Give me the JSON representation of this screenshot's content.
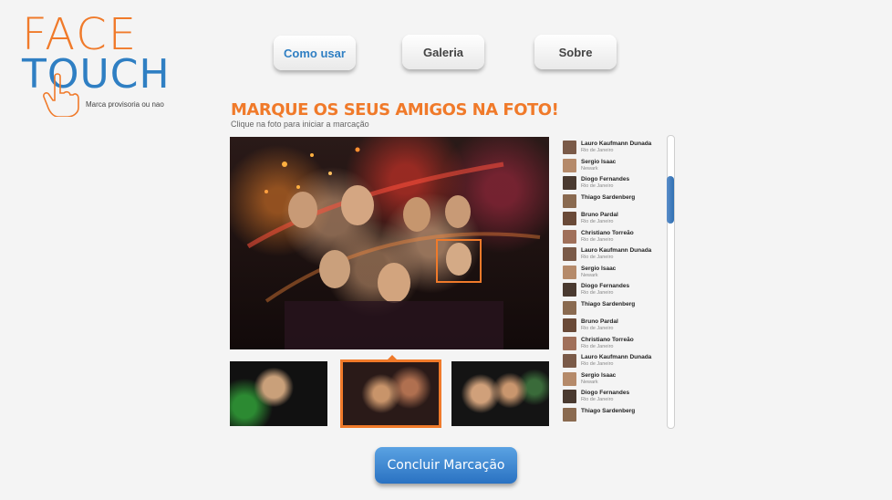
{
  "logo": {
    "face": "FACE",
    "touch": "TOUCH",
    "tagline": "Marca provisoria ou nao"
  },
  "nav": {
    "como_usar": "Como usar",
    "galeria": "Galeria",
    "sobre": "Sobre"
  },
  "heading": "MARQUE OS SEUS AMIGOS NA FOTO!",
  "subheading": "Clique na foto para iniciar a marcação",
  "friends": [
    {
      "name": "Lauro Kaufmann Dunada",
      "location": "Rio de Janeiro"
    },
    {
      "name": "Sergio Isaac",
      "location": "Newark"
    },
    {
      "name": "Diogo Fernandes",
      "location": "Rio de Janeiro"
    },
    {
      "name": "Thiago Sardenberg",
      "location": ""
    },
    {
      "name": "Bruno Pardal",
      "location": "Rio de Janeiro"
    },
    {
      "name": "Christiano Torreão",
      "location": "Rio de Janeiro"
    },
    {
      "name": "Lauro Kaufmann Dunada",
      "location": "Rio de Janeiro"
    },
    {
      "name": "Sergio Isaac",
      "location": "Newark"
    },
    {
      "name": "Diogo Fernandes",
      "location": "Rio de Janeiro"
    },
    {
      "name": "Thiago Sardenberg",
      "location": ""
    },
    {
      "name": "Bruno Pardal",
      "location": "Rio de Janeiro"
    },
    {
      "name": "Christiano Torreão",
      "location": "Rio de Janeiro"
    },
    {
      "name": "Lauro Kaufmann Dunada",
      "location": "Rio de Janeiro"
    },
    {
      "name": "Sergio Isaac",
      "location": "Newark"
    },
    {
      "name": "Diogo Fernandes",
      "location": "Rio de Janeiro"
    },
    {
      "name": "Thiago Sardenberg",
      "location": ""
    }
  ],
  "avatar_colors": [
    "#7a5a48",
    "#b58a6a",
    "#4a3a30",
    "#8a6a50",
    "#6a4a38",
    "#a0705a"
  ],
  "concluir_label": "Concluir Marcação",
  "colors": {
    "accent_orange": "#f07a2a",
    "accent_blue": "#2f7fc3",
    "background": "#f4f4f4"
  }
}
